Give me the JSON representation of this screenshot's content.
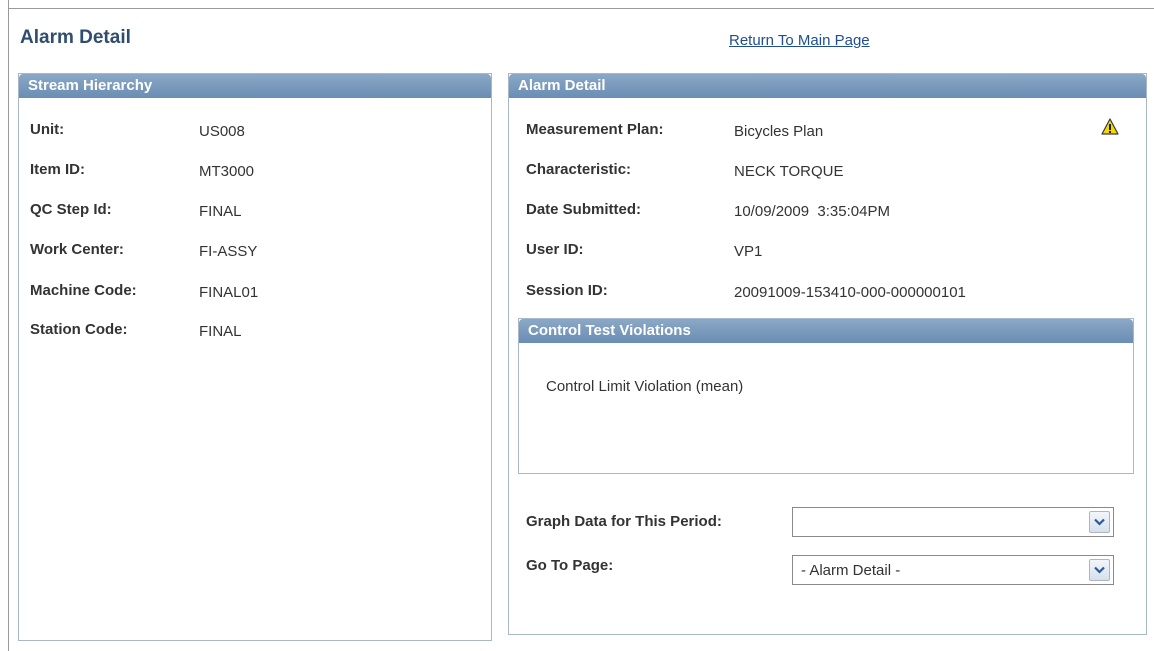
{
  "page": {
    "title": "Alarm Detail",
    "return_link": "Return To Main Page"
  },
  "stream_hierarchy": {
    "header": "Stream Hierarchy",
    "rows": [
      {
        "label": "Unit:",
        "value": "US008"
      },
      {
        "label": "Item ID:",
        "value": "MT3000"
      },
      {
        "label": "QC Step Id:",
        "value": "FINAL"
      },
      {
        "label": "Work Center:",
        "value": "FI-ASSY"
      },
      {
        "label": "Machine Code:",
        "value": "FINAL01"
      },
      {
        "label": "Station Code:",
        "value": "FINAL"
      }
    ]
  },
  "alarm_detail": {
    "header": "Alarm Detail",
    "rows": [
      {
        "label": "Measurement Plan:",
        "value": "Bicycles Plan"
      },
      {
        "label": "Characteristic:",
        "value": "NECK TORQUE"
      },
      {
        "label": "Date Submitted:",
        "value": "10/09/2009  3:35:04PM"
      },
      {
        "label": "User ID:",
        "value": "VP1"
      },
      {
        "label": "Session ID:",
        "value": "20091009-153410-000-000000101"
      }
    ],
    "warning_icon": "warning-triangle-icon"
  },
  "control_test_violations": {
    "header": "Control Test Violations",
    "text": "Control Limit Violation (mean)"
  },
  "graph_data": {
    "label": "Graph Data for This Period:",
    "value": ""
  },
  "go_to_page": {
    "label": "Go To Page:",
    "value": "- Alarm Detail -"
  },
  "colors": {
    "header_bg": "#7a9bbf",
    "title": "#2e4d6f",
    "link": "#1f4f91",
    "warning": "#f5d800"
  }
}
